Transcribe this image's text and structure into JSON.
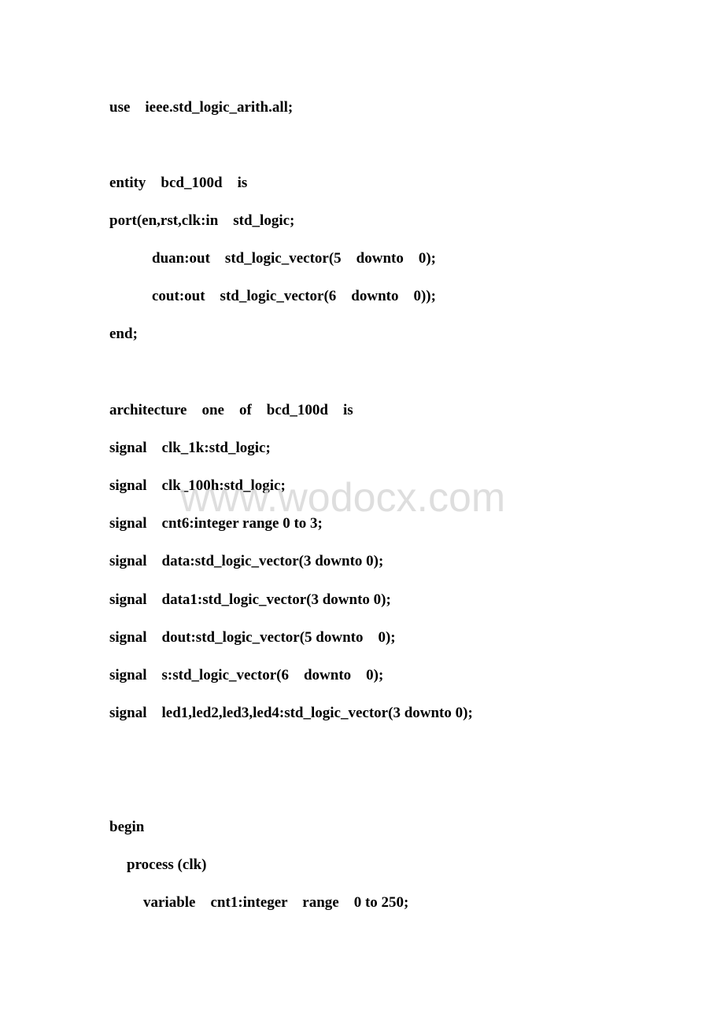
{
  "document": {
    "lines": [
      "use    ieee.std_logic_arith.all;",
      "entity    bcd_100d    is",
      "port(en,rst,clk:in    std_logic;",
      "duan:out    std_logic_vector(5    downto    0);",
      "cout:out    std_logic_vector(6    downto    0));",
      "end;",
      "architecture    one    of    bcd_100d    is",
      "signal    clk_1k:std_logic;",
      "signal    clk_100h:std_logic;",
      "signal    cnt6:integer range 0 to 3;",
      "signal    data:std_logic_vector(3 downto 0);",
      "signal    data1:std_logic_vector(3 downto 0);",
      "signal    dout:std_logic_vector(5 downto    0);",
      "signal    s:std_logic_vector(6    downto    0);",
      "signal    led1,led2,led3,led4:std_logic_vector(3 downto 0);",
      "begin",
      "process (clk)",
      "variable    cnt1:integer    range    0 to 250;"
    ]
  },
  "watermark": {
    "text": "www.wodocx.com",
    "color": "#d9d9d9"
  }
}
